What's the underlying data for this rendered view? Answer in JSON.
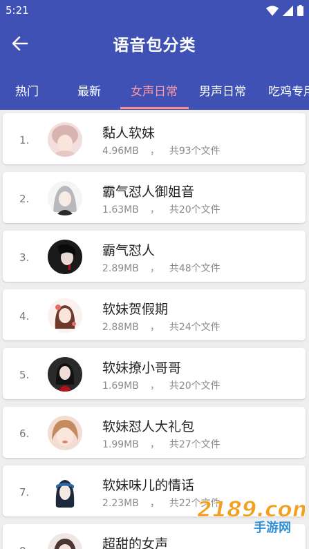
{
  "status_bar": {
    "time": "5:21"
  },
  "toolbar": {
    "title": "语音包分类"
  },
  "tabs": [
    {
      "label": "热门"
    },
    {
      "label": "最新"
    },
    {
      "label": "女声日常"
    },
    {
      "label": "男声日常"
    },
    {
      "label": "吃鸡专用"
    }
  ],
  "active_tab": "女声日常",
  "items": [
    {
      "rank": "1.",
      "name": "黏人软妹",
      "size": "4.96MB",
      "separator": "，",
      "count": "共93个文件"
    },
    {
      "rank": "2.",
      "name": "霸气怼人御姐音",
      "size": "1.63MB",
      "separator": "，",
      "count": "共20个文件"
    },
    {
      "rank": "3.",
      "name": "霸气怼人",
      "size": "2.89MB",
      "separator": "，",
      "count": "共48个文件"
    },
    {
      "rank": "4.",
      "name": "软妹贺假期",
      "size": "2.88MB",
      "separator": "，",
      "count": "共24个文件"
    },
    {
      "rank": "5.",
      "name": "软妹撩小哥哥",
      "size": "1.69MB",
      "separator": "，",
      "count": "共20个文件"
    },
    {
      "rank": "6.",
      "name": "软妹怼人大礼包",
      "size": "1.99MB",
      "separator": "，",
      "count": "共27个文件"
    },
    {
      "rank": "7.",
      "name": "软妹味儿的情话",
      "size": "2.23MB",
      "separator": "，",
      "count": "共22个文件"
    },
    {
      "rank": "8.",
      "name": "超甜的女声",
      "size": "",
      "separator": "",
      "count": ""
    }
  ],
  "watermark": {
    "brand": "2189.com",
    "sub": "手游网"
  },
  "colors": {
    "primary": "#3f51b5",
    "tab_active": "#ff8f96",
    "background": "#eeeeee"
  }
}
